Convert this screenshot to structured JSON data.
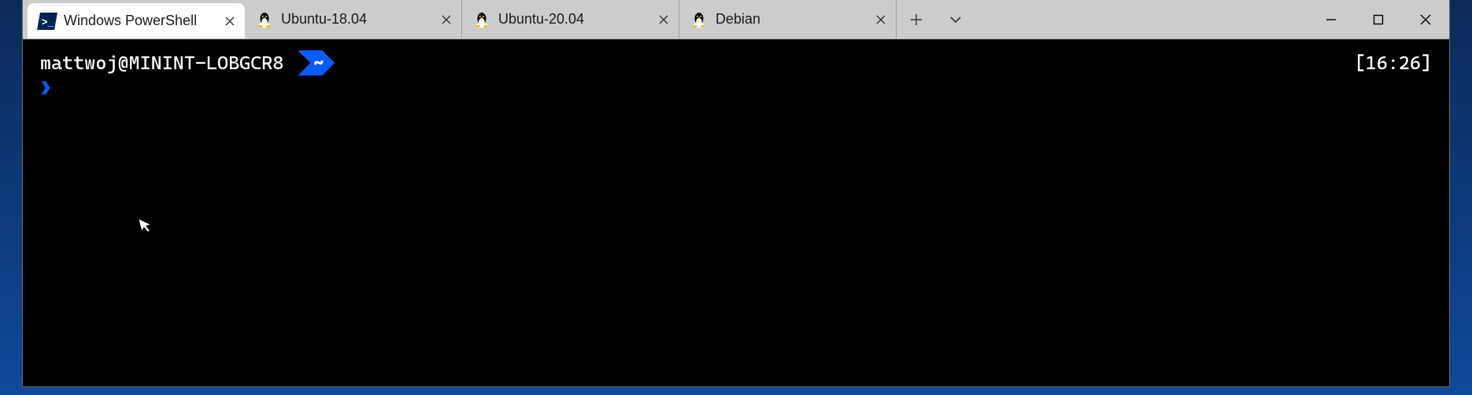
{
  "tabs": [
    {
      "label": "Windows PowerShell",
      "icon": "powershell-icon",
      "active": true
    },
    {
      "label": "Ubuntu-18.04",
      "icon": "tux-icon",
      "active": false
    },
    {
      "label": "Ubuntu-20.04",
      "icon": "tux-icon",
      "active": false
    },
    {
      "label": "Debian",
      "icon": "tux-icon",
      "active": false
    }
  ],
  "prompt": {
    "user_host": "mattwoj@MININT-LOBGCR8",
    "path": "~",
    "clock": "[16:26]",
    "caret": "❯"
  }
}
